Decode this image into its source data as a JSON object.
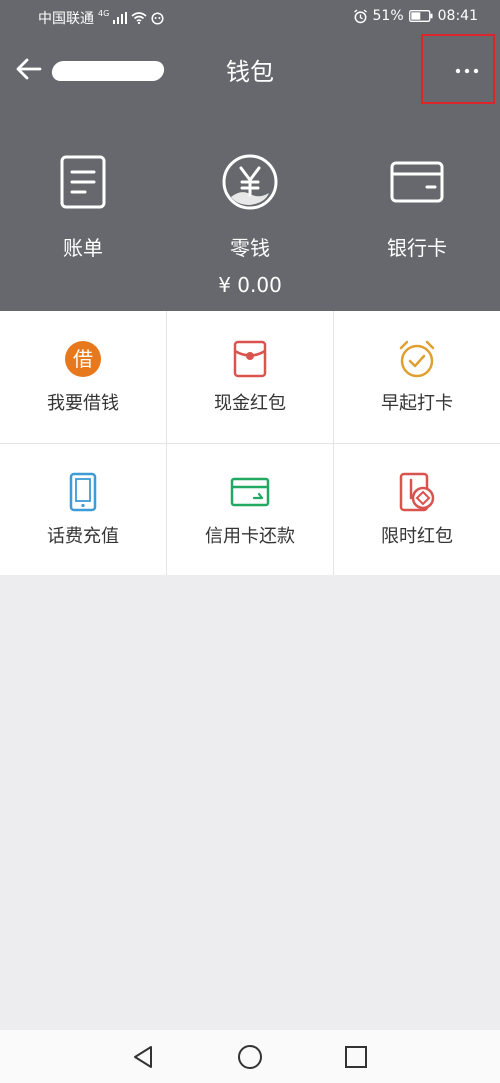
{
  "status_bar": {
    "carrier": "中国联通",
    "network": "4G",
    "battery": "51%",
    "time": "08:41"
  },
  "header": {
    "title": "钱包"
  },
  "top_actions": [
    {
      "label": "账单",
      "icon": "bill-icon"
    },
    {
      "label": "零钱",
      "icon": "yuan-coin-icon",
      "amount": "¥ 0.00"
    },
    {
      "label": "银行卡",
      "icon": "bank-card-icon"
    }
  ],
  "services": [
    {
      "label": "我要借钱",
      "icon": "loan-icon",
      "icon_text": "借",
      "color": "#e8781c"
    },
    {
      "label": "现金红包",
      "icon": "cash-red-packet-icon",
      "color": "#d9534f"
    },
    {
      "label": "早起打卡",
      "icon": "alarm-clock-icon",
      "color": "#e0a030"
    },
    {
      "label": "话费充值",
      "icon": "phone-recharge-icon",
      "color": "#3d9bd6"
    },
    {
      "label": "信用卡还款",
      "icon": "credit-card-icon",
      "color": "#21a862"
    },
    {
      "label": "限时红包",
      "icon": "limited-red-packet-icon",
      "color": "#d9534f"
    }
  ],
  "colors": {
    "header_bg": "#66686e",
    "page_bg": "#ededf0",
    "highlight_border": "#d9252b"
  }
}
